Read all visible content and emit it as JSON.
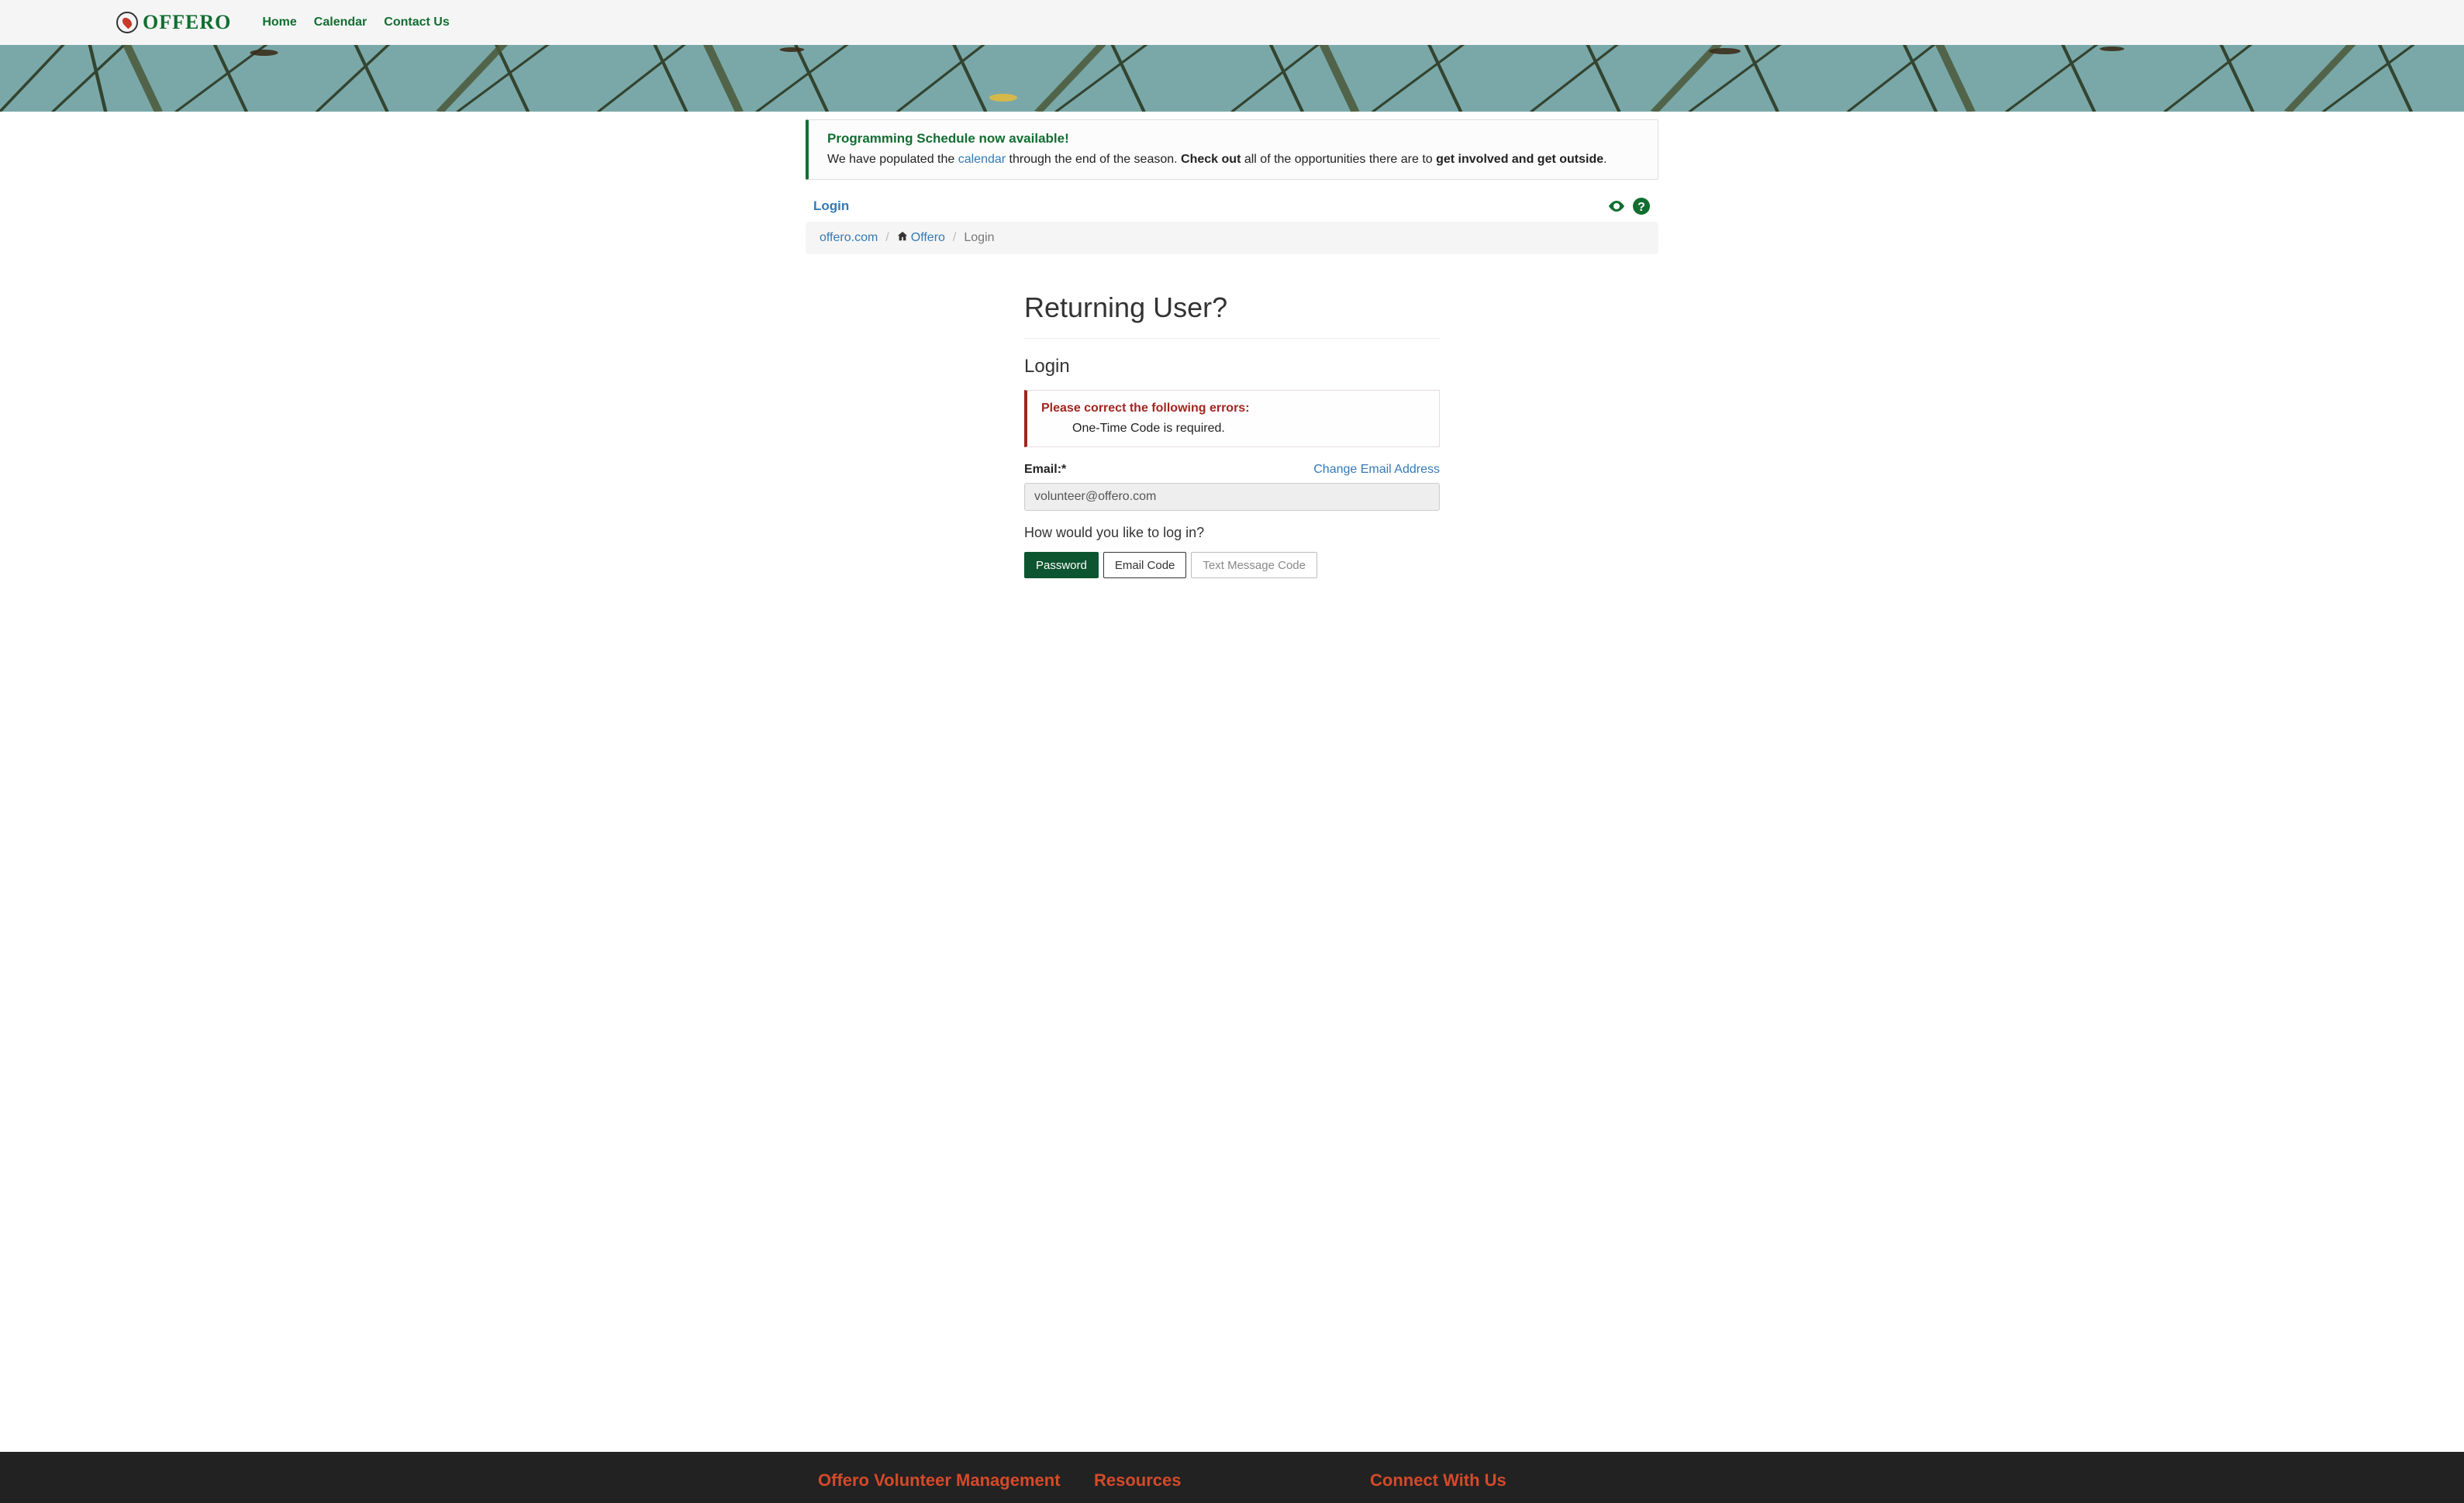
{
  "brand": {
    "name": "OFFERO"
  },
  "nav": {
    "home": "Home",
    "calendar": "Calendar",
    "contact": "Contact Us"
  },
  "notice": {
    "title": "Programming Schedule now available!",
    "pre": "We have populated the ",
    "calendar_link": "calendar",
    "mid": " through the end of the season. ",
    "bold1": "Check out",
    "post": " all of the opportunities there are to ",
    "bold2": "get involved and get outside",
    "end": "."
  },
  "page_head": {
    "login": "Login"
  },
  "breadcrumb": {
    "site": "offero.com",
    "home": "Offero",
    "current": "Login"
  },
  "login": {
    "heading": "Returning User?",
    "subhead": "Login",
    "error_title": "Please correct the following errors:",
    "error_items": [
      "One-Time Code is required."
    ],
    "email_label": "Email:*",
    "change_email": "Change Email Address",
    "email_value": "volunteer@offero.com",
    "prompt": "How would you like to log in?",
    "btn_password": "Password",
    "btn_email_code": "Email Code",
    "btn_sms_code": "Text Message Code"
  },
  "footer": {
    "col1": "Offero Volunteer Management",
    "col2": "Resources",
    "col3": "Connect With Us"
  }
}
